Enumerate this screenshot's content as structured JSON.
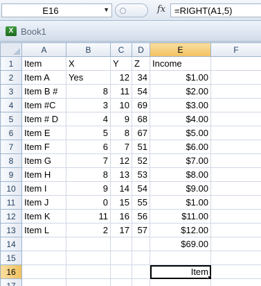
{
  "formula_bar": {
    "name_box": "E16",
    "fx_label": "fx",
    "formula": "=RIGHT(A1,5)"
  },
  "workbook": {
    "title": "Book1"
  },
  "grid": {
    "columns": [
      "A",
      "B",
      "C",
      "D",
      "E",
      "F"
    ],
    "selected_column": "E",
    "selected_row": "16",
    "rows": [
      {
        "n": "1",
        "cells": [
          "Item",
          "X",
          "Y",
          "Z",
          "Income",
          ""
        ]
      },
      {
        "n": "2",
        "cells": [
          "Item A",
          "Yes",
          "12",
          "34",
          "$1.00",
          ""
        ]
      },
      {
        "n": "3",
        "cells": [
          "Item B #",
          "8",
          "11",
          "54",
          "$2.00",
          ""
        ]
      },
      {
        "n": "4",
        "cells": [
          "Item #C",
          "3",
          "10",
          "69",
          "$3.00",
          ""
        ]
      },
      {
        "n": "5",
        "cells": [
          "Item # D",
          "4",
          "9",
          "68",
          "$4.00",
          ""
        ]
      },
      {
        "n": "6",
        "cells": [
          "Item E",
          "5",
          "8",
          "67",
          "$5.00",
          ""
        ]
      },
      {
        "n": "7",
        "cells": [
          "Item F",
          "6",
          "7",
          "51",
          "$6.00",
          ""
        ]
      },
      {
        "n": "8",
        "cells": [
          "Item G",
          "7",
          "12",
          "52",
          "$7.00",
          ""
        ]
      },
      {
        "n": "9",
        "cells": [
          "Item H",
          "8",
          "13",
          "53",
          "$8.00",
          ""
        ]
      },
      {
        "n": "10",
        "cells": [
          "Item I",
          "9",
          "14",
          "54",
          "$9.00",
          ""
        ]
      },
      {
        "n": "11",
        "cells": [
          "Item J",
          "0",
          "15",
          "55",
          "$1.00",
          ""
        ]
      },
      {
        "n": "12",
        "cells": [
          "Item K",
          "11",
          "16",
          "56",
          "$11.00",
          ""
        ]
      },
      {
        "n": "13",
        "cells": [
          "Item L",
          "2",
          "17",
          "57",
          "$12.00",
          ""
        ]
      },
      {
        "n": "14",
        "cells": [
          "",
          "",
          "",
          "",
          "$69.00",
          ""
        ]
      },
      {
        "n": "15",
        "cells": [
          "",
          "",
          "",
          "",
          "",
          ""
        ]
      },
      {
        "n": "16",
        "cells": [
          "",
          "",
          "",
          "",
          "Item",
          ""
        ]
      },
      {
        "n": "17",
        "cells": [
          "",
          "",
          "",
          "",
          "",
          ""
        ]
      }
    ]
  }
}
